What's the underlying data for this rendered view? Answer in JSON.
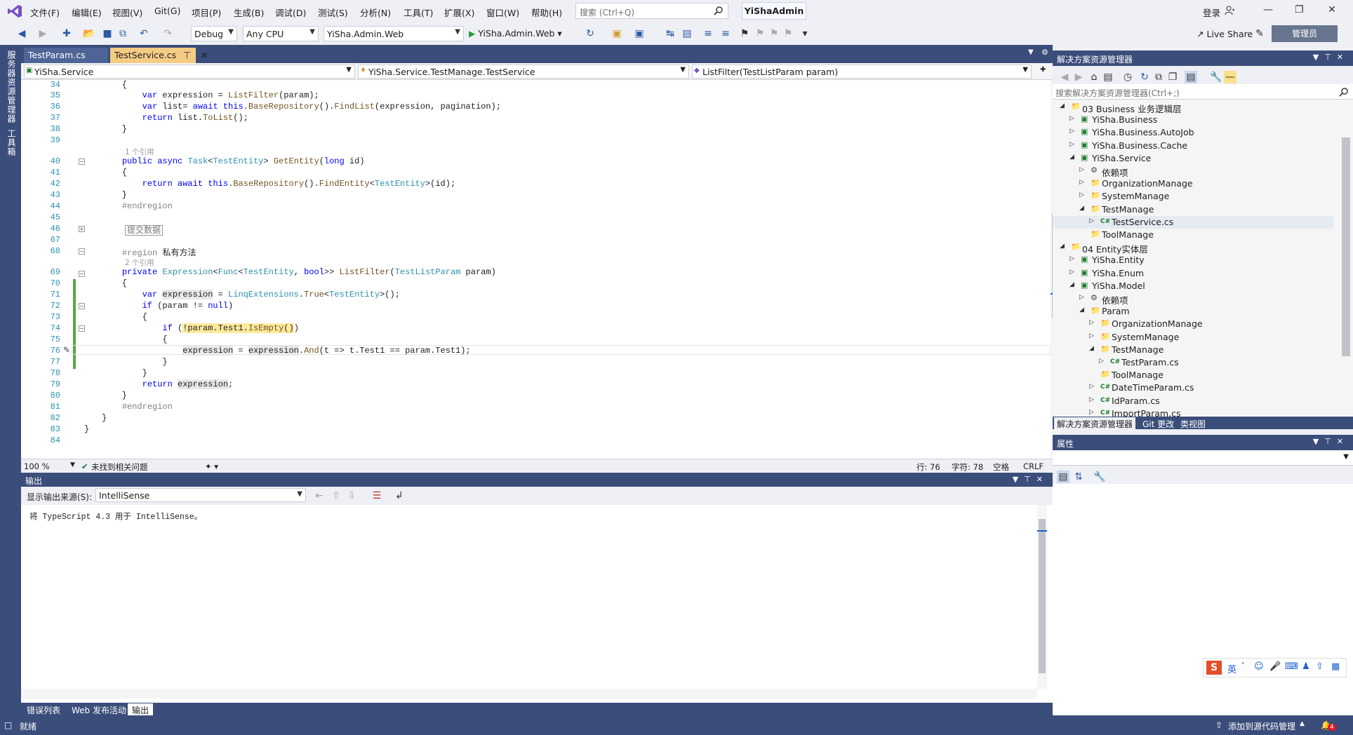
{
  "menu": {
    "items": [
      "文件(F)",
      "编辑(E)",
      "视图(V)",
      "Git(G)",
      "项目(P)",
      "生成(B)",
      "调试(D)",
      "测试(S)",
      "分析(N)",
      "工具(T)",
      "扩展(X)",
      "窗口(W)",
      "帮助(H)"
    ],
    "search_placeholder": "搜索 (Ctrl+Q)",
    "solution_name": "YiShaAdmin",
    "login": "登录"
  },
  "toolbar": {
    "config": "Debug",
    "platform": "Any CPU",
    "startup_project": "YiSha.Admin.Web",
    "run_label": "YiSha.Admin.Web",
    "liveshare": "Live Share",
    "admin_badge": "管理员"
  },
  "left_strip": [
    "服务器资源管理器",
    "工具箱"
  ],
  "doc_tabs": [
    {
      "label": "TestParam.cs",
      "active": false
    },
    {
      "label": "TestService.cs",
      "active": true
    }
  ],
  "navbar": {
    "project": "YiSha.Service",
    "class": "YiSha.Service.TestManage.TestService",
    "member": "ListFilter(TestListParam param)"
  },
  "editor": {
    "line_numbers": [
      "34",
      "35",
      "36",
      "37",
      "38",
      "39",
      "40",
      "41",
      "42",
      "43",
      "44",
      "45",
      "46",
      "67",
      "68",
      "69",
      "70",
      "71",
      "72",
      "73",
      "74",
      "75",
      "76",
      "77",
      "78",
      "79",
      "80",
      "81",
      "82",
      "83",
      "84"
    ],
    "ref_1": "1 个引用",
    "ref_2": "2 个引用",
    "collapsed_label": "提交数据",
    "region_private": "私有方法"
  },
  "edit_status": {
    "zoom": "100 %",
    "issues": "未找到相关问题",
    "line": "行: 76",
    "char": "字符: 78",
    "spacing": "空格",
    "eol": "CRLF"
  },
  "output": {
    "title": "输出",
    "source_label": "显示输出来源(S):",
    "source_value": "IntelliSense",
    "text": "将 TypeScript 4.3 用于 IntelliSense。",
    "tabs": [
      "错误列表",
      "Web 发布活动",
      "输出"
    ]
  },
  "solution_explorer": {
    "title": "解决方案资源管理器",
    "search_placeholder": "搜索解决方案资源管理器(Ctrl+;)",
    "tree": [
      {
        "label": "03 Business 业务逻辑层",
        "level": 0,
        "kind": "folder",
        "exp": "open"
      },
      {
        "label": "YiSha.Business",
        "level": 1,
        "kind": "proj",
        "exp": "closed"
      },
      {
        "label": "YiSha.Business.AutoJob",
        "level": 1,
        "kind": "proj",
        "exp": "closed"
      },
      {
        "label": "YiSha.Business.Cache",
        "level": 1,
        "kind": "proj",
        "exp": "closed"
      },
      {
        "label": "YiSha.Service",
        "level": 1,
        "kind": "proj",
        "exp": "open"
      },
      {
        "label": "依赖项",
        "level": 2,
        "kind": "dep",
        "exp": "closed"
      },
      {
        "label": "OrganizationManage",
        "level": 2,
        "kind": "folder",
        "exp": "closed"
      },
      {
        "label": "SystemManage",
        "level": 2,
        "kind": "folder",
        "exp": "closed"
      },
      {
        "label": "TestManage",
        "level": 2,
        "kind": "folder",
        "exp": "open"
      },
      {
        "label": "TestService.cs",
        "level": 3,
        "kind": "cs",
        "exp": "closed",
        "selected": true
      },
      {
        "label": "ToolManage",
        "level": 2,
        "kind": "miss",
        "exp": "none"
      },
      {
        "label": "04 Entity实体层",
        "level": 0,
        "kind": "folder",
        "exp": "open"
      },
      {
        "label": "YiSha.Entity",
        "level": 1,
        "kind": "proj",
        "exp": "closed"
      },
      {
        "label": "YiSha.Enum",
        "level": 1,
        "kind": "proj",
        "exp": "closed"
      },
      {
        "label": "YiSha.Model",
        "level": 1,
        "kind": "proj",
        "exp": "open"
      },
      {
        "label": "依赖项",
        "level": 2,
        "kind": "dep",
        "exp": "closed"
      },
      {
        "label": "Param",
        "level": 2,
        "kind": "folder",
        "exp": "open"
      },
      {
        "label": "OrganizationManage",
        "level": 3,
        "kind": "folder",
        "exp": "closed"
      },
      {
        "label": "SystemManage",
        "level": 3,
        "kind": "folder",
        "exp": "closed"
      },
      {
        "label": "TestManage",
        "level": 3,
        "kind": "folder",
        "exp": "open"
      },
      {
        "label": "TestParam.cs",
        "level": 4,
        "kind": "cs",
        "exp": "closed"
      },
      {
        "label": "ToolManage",
        "level": 3,
        "kind": "miss",
        "exp": "none"
      },
      {
        "label": "DateTimeParam.cs",
        "level": 3,
        "kind": "cs",
        "exp": "closed"
      },
      {
        "label": "IdParam.cs",
        "level": 3,
        "kind": "cs",
        "exp": "closed"
      },
      {
        "label": "ImportParam.cs",
        "level": 3,
        "kind": "cs",
        "exp": "closed"
      }
    ],
    "tabs": [
      "解决方案资源管理器",
      "Git 更改",
      "类视图"
    ]
  },
  "properties": {
    "title": "属性"
  },
  "ime": {
    "label": "英"
  },
  "statusbar": {
    "ready": "就绪",
    "source_control": "添加到源代码管理",
    "notifications": "4"
  },
  "colors": {
    "accent": "#3b4d7a",
    "active_tab": "#f5cc84",
    "keyword": "#0000ff",
    "type": "#2b91af"
  }
}
